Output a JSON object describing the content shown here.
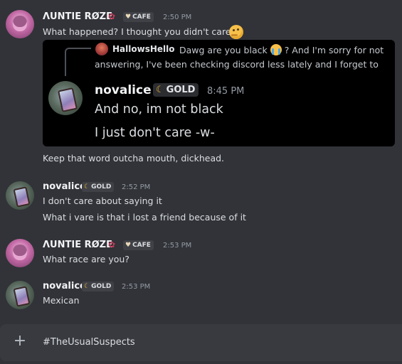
{
  "messages": [
    {
      "author": "ΛUNTIE RØZE",
      "tag": "CAFE",
      "time": "2:50 PM",
      "lines": [
        "What happened? I thought you didn't care?"
      ],
      "forwarded": {
        "reply_author": "HallowsHello",
        "reply_text_1a": "Dawg are you black",
        "reply_text_1b": "? And I'm sorry for not",
        "reply_text_2": "answering, I've been checking discord less lately and I forget to",
        "author": "novalice",
        "tag": "GOLD",
        "time": "8:45 PM",
        "lines": [
          "And no, im not black",
          "I just don't care -w-"
        ]
      },
      "after": "Keep that word outcha mouth, dickhead."
    },
    {
      "author": "novalice",
      "tag": "GOLD",
      "time": "2:52 PM",
      "lines": [
        "I don't care about saying it",
        "What i vare is that i lost a friend because of it"
      ]
    },
    {
      "author": "ΛUNTIE RØZE",
      "tag": "CAFE",
      "time": "2:53 PM",
      "lines": [
        "What race are you?"
      ]
    },
    {
      "author": "novalice",
      "tag": "GOLD",
      "time": "2:53 PM",
      "lines": [
        "Mexican"
      ]
    }
  ],
  "composer": {
    "placeholder": "#TheUsualSuspects"
  },
  "icons": {
    "gold_badge": "moon-icon",
    "cafe_badge": "heart-icon",
    "name_decoration": "rose-icon",
    "add": "plus-icon"
  },
  "colors": {
    "background": "#313338",
    "embed_background": "#000000",
    "composer": "#383a40",
    "gold": "#f0b232"
  }
}
